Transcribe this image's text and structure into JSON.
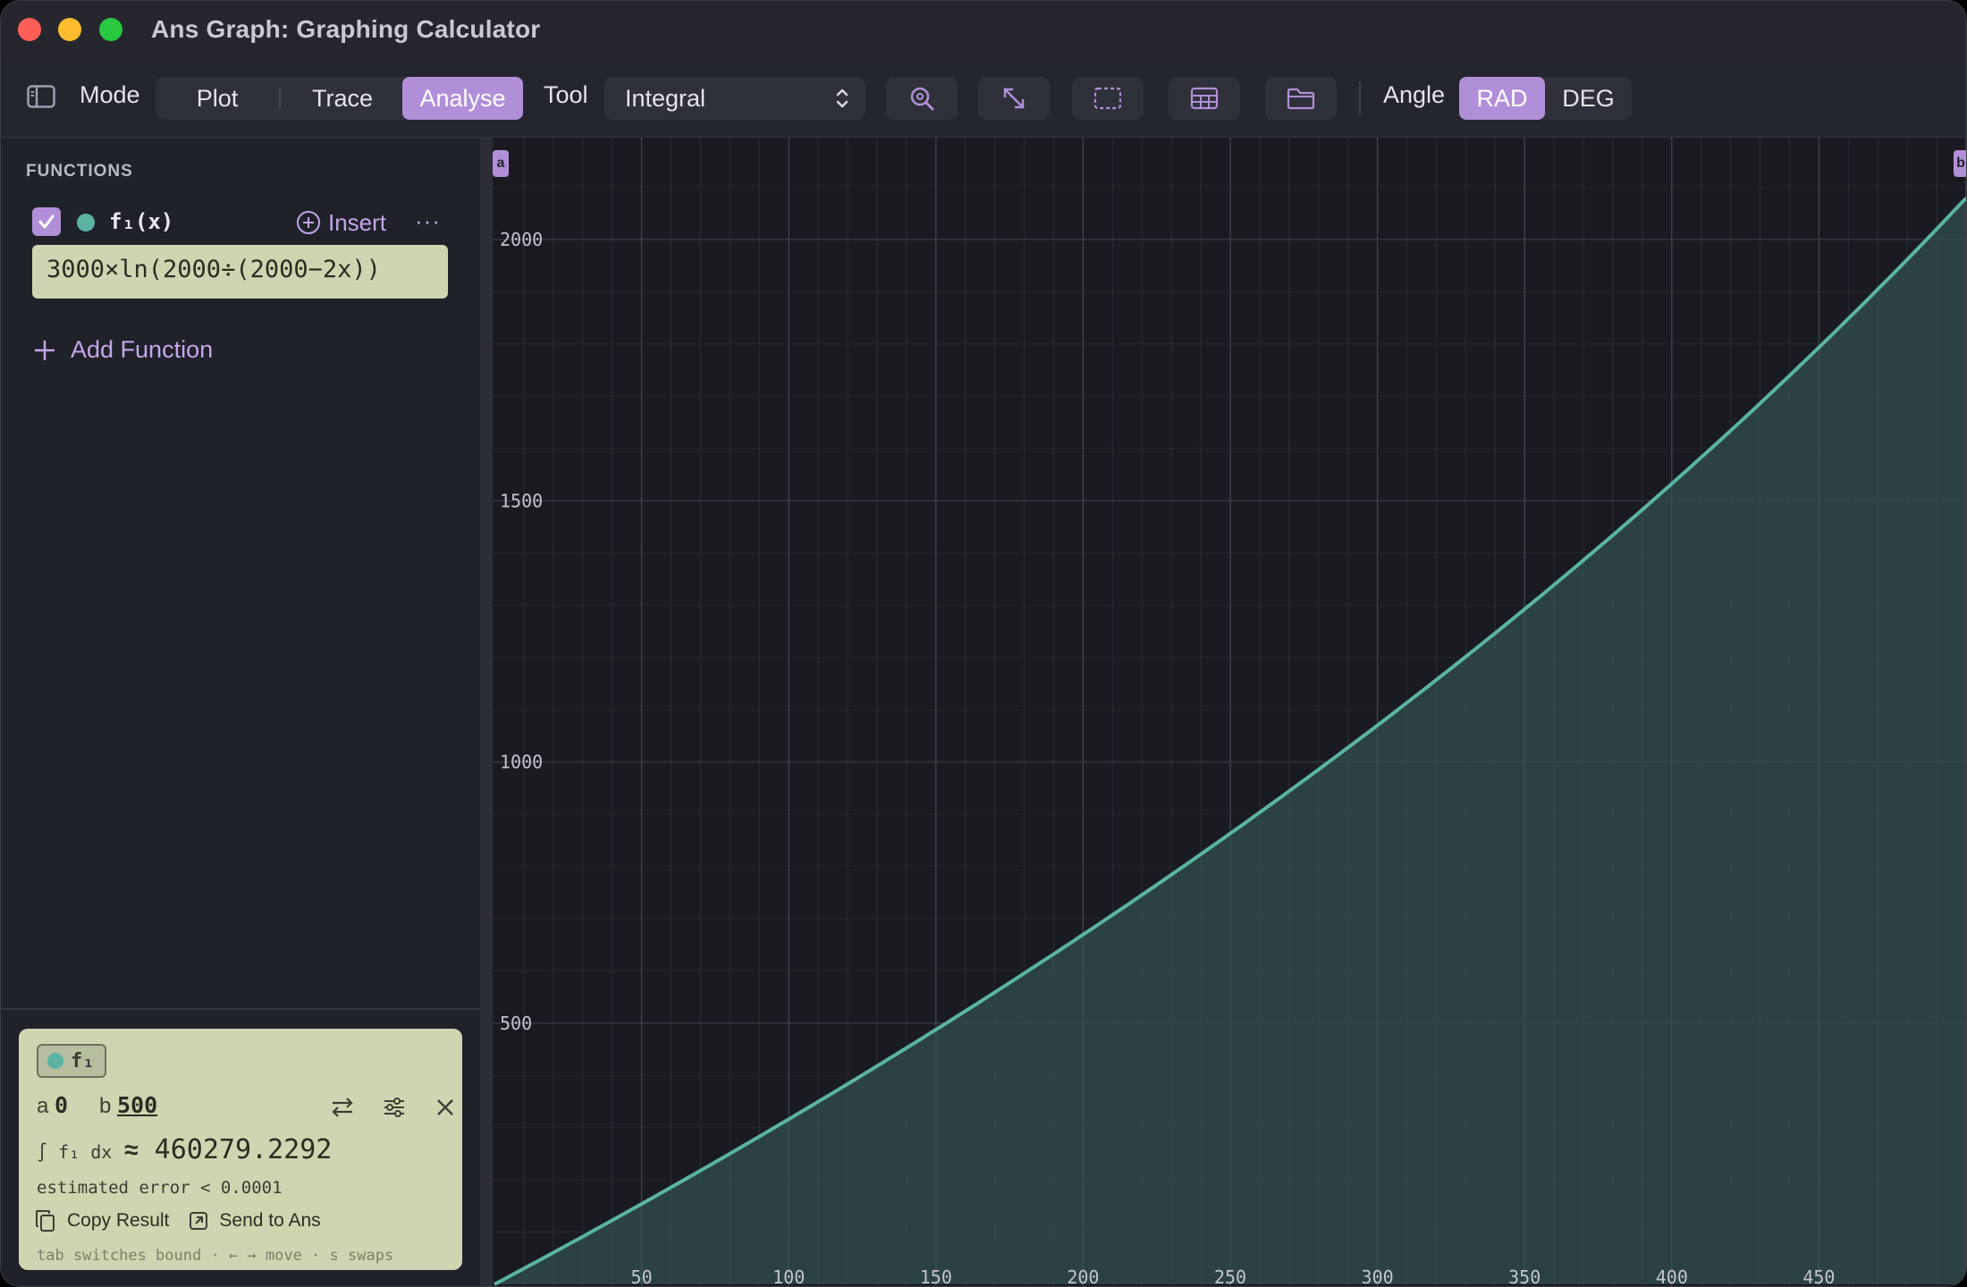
{
  "window": {
    "title": "Ans Graph: Graphing Calculator"
  },
  "toolbar": {
    "mode_label": "Mode",
    "modes": [
      "Plot",
      "Trace",
      "Analyse"
    ],
    "active_mode": "Analyse",
    "tool_label": "Tool",
    "tool_value": "Integral",
    "icons": [
      "zoom-icon",
      "fit-icon",
      "selection-icon",
      "table-icon",
      "folder-icon"
    ],
    "angle_label": "Angle",
    "angle_units": [
      "RAD",
      "DEG"
    ],
    "active_angle": "RAD"
  },
  "sidebar": {
    "heading": "FUNCTIONS",
    "functions": [
      {
        "name": "f₁(x)",
        "enabled": true,
        "color": "#5ab3a3",
        "expression": "3000×ln(2000÷(2000−2x))"
      }
    ],
    "insert_label": "Insert",
    "more_label": "···",
    "add_function_label": "Add Function"
  },
  "result": {
    "function_chip": "f₁",
    "bound_a_label": "a",
    "bound_a_value": "0",
    "bound_b_label": "b",
    "bound_b_value": "500",
    "integral_expr": "∫ f₁ dx",
    "approx_symbol": "≈",
    "integral_value": "460279.2292",
    "error_text": "estimated error < 0.0001",
    "copy_label": "Copy Result",
    "send_label": "Send to Ans",
    "hint": "tab switches bound · ← → move · s swaps"
  },
  "graph": {
    "curve_color": "#5ab3a3",
    "fill_color": "#2f4a4a",
    "bound_a_marker": "a",
    "bound_b_marker": "b"
  },
  "chart_data": {
    "type": "area",
    "function": "3000*ln(2000/(2000-2x))",
    "integral_bounds": [
      0,
      500
    ],
    "x_ticks": [
      "50",
      "100",
      "150",
      "200",
      "250",
      "300",
      "350",
      "400",
      "450"
    ],
    "y_ticks": [
      "500",
      "1000",
      "1500",
      "2000"
    ],
    "xlim": [
      0,
      500
    ],
    "ylim": [
      0,
      2200
    ],
    "grid": true
  }
}
